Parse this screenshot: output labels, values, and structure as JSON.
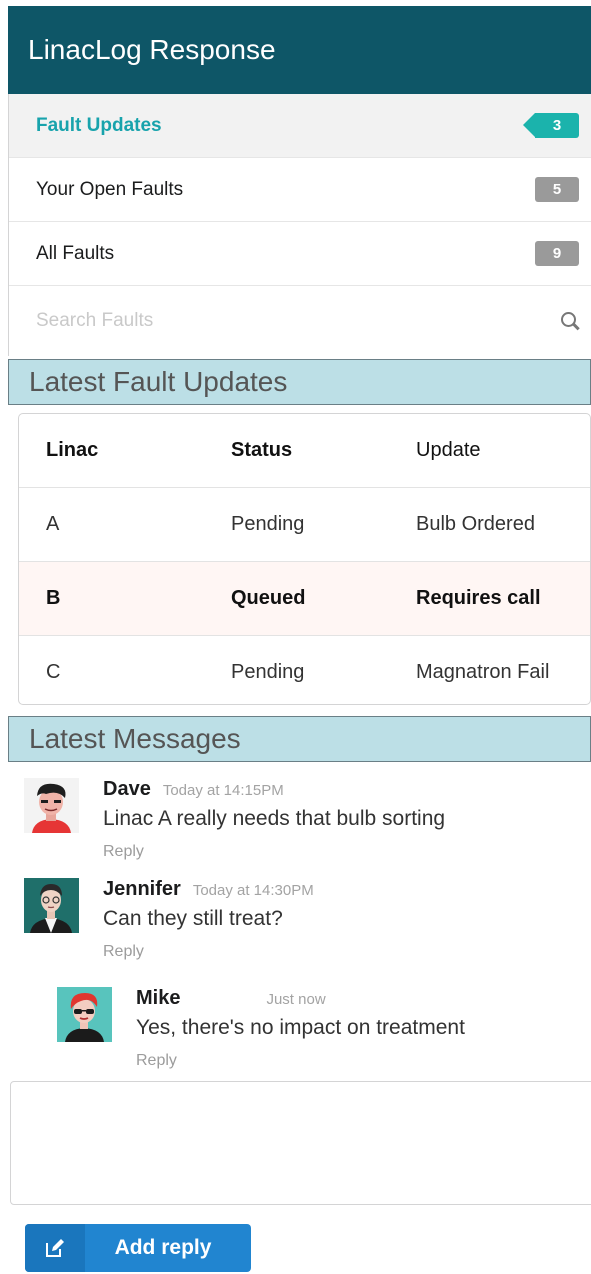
{
  "app": {
    "title": "LinacLog Response"
  },
  "menu": {
    "items": [
      {
        "label": "Fault Updates",
        "count": "3"
      },
      {
        "label": "Your Open Faults",
        "count": "5"
      },
      {
        "label": "All Faults",
        "count": "9"
      }
    ],
    "search_placeholder": "Search Faults"
  },
  "fault_updates": {
    "title": "Latest Fault Updates",
    "columns": [
      "Linac",
      "Status",
      "Update"
    ],
    "rows": [
      {
        "linac": "A",
        "status": "Pending",
        "update": "Bulb Ordered"
      },
      {
        "linac": "B",
        "status": "Queued",
        "update": "Requires call"
      },
      {
        "linac": "C",
        "status": "Pending",
        "update": "Magnatron Fail"
      }
    ]
  },
  "messages": {
    "title": "Latest Messages",
    "items": [
      {
        "author": "Dave",
        "time": "Today at 14:15PM",
        "text": "Linac A really needs that bulb sorting",
        "reply": "Reply",
        "avatar": "dave-avatar"
      },
      {
        "author": "Jennifer",
        "time": "Today  at 14:30PM",
        "text": "Can they still treat?",
        "reply": "Reply",
        "avatar": "jennifer-avatar"
      },
      {
        "author": "Mike",
        "time": "Just now",
        "text": "Yes, there's no impact on treatment",
        "reply": "Reply",
        "avatar": "mike-avatar"
      }
    ]
  },
  "reply_form": {
    "button_label": "Add reply",
    "icon": "edit-icon"
  },
  "colors": {
    "header": "#0e5667",
    "accent": "#1bb3ac",
    "section": "#bcdfe6",
    "button": "#2185d0"
  }
}
